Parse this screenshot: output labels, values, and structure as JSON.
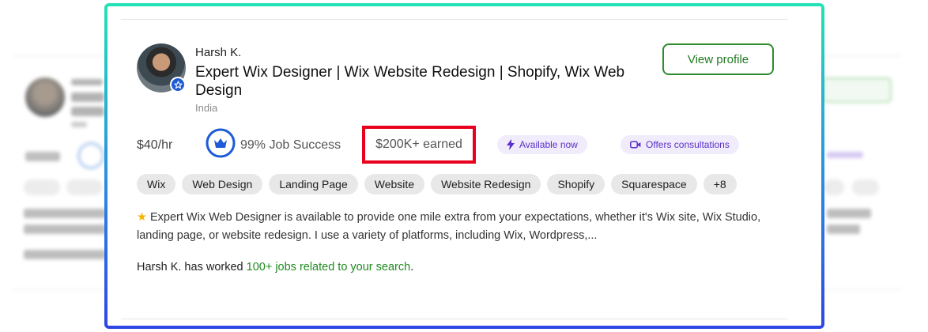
{
  "freelancer": {
    "name": "Harsh K.",
    "title": "Expert Wix Designer | Wix Website Redesign | Shopify, Wix Web Design",
    "country": "India",
    "view_profile_label": "View profile",
    "rate": "$40/hr",
    "job_success": "99% Job Success",
    "job_success_fraction": 0.99,
    "earned": "$200K+ earned",
    "available_badge": "Available now",
    "consultations_badge": "Offers consultations",
    "skills": [
      "Wix",
      "Web Design",
      "Landing Page",
      "Website",
      "Website Redesign",
      "Shopify",
      "Squarespace",
      "+8"
    ],
    "description": "Expert Wix Web Designer is available to provide one mile extra from your expectations, whether it's Wix site, Wix Studio, landing page, or website redesign. I use a variety of platforms, including Wix, Wordpress,...",
    "worked_prefix": "Harsh K. has worked",
    "worked_link": "100+ jobs related to your search",
    "worked_suffix": "."
  },
  "colors": {
    "highlight_border": "#e8001c",
    "accent_green": "#1f8a1f",
    "badge_purple": "#5b2fc9",
    "verified_blue": "#1e5bd6",
    "frame_gradient_top": "#25e2b6",
    "frame_gradient_bottom": "#2f45e6"
  }
}
